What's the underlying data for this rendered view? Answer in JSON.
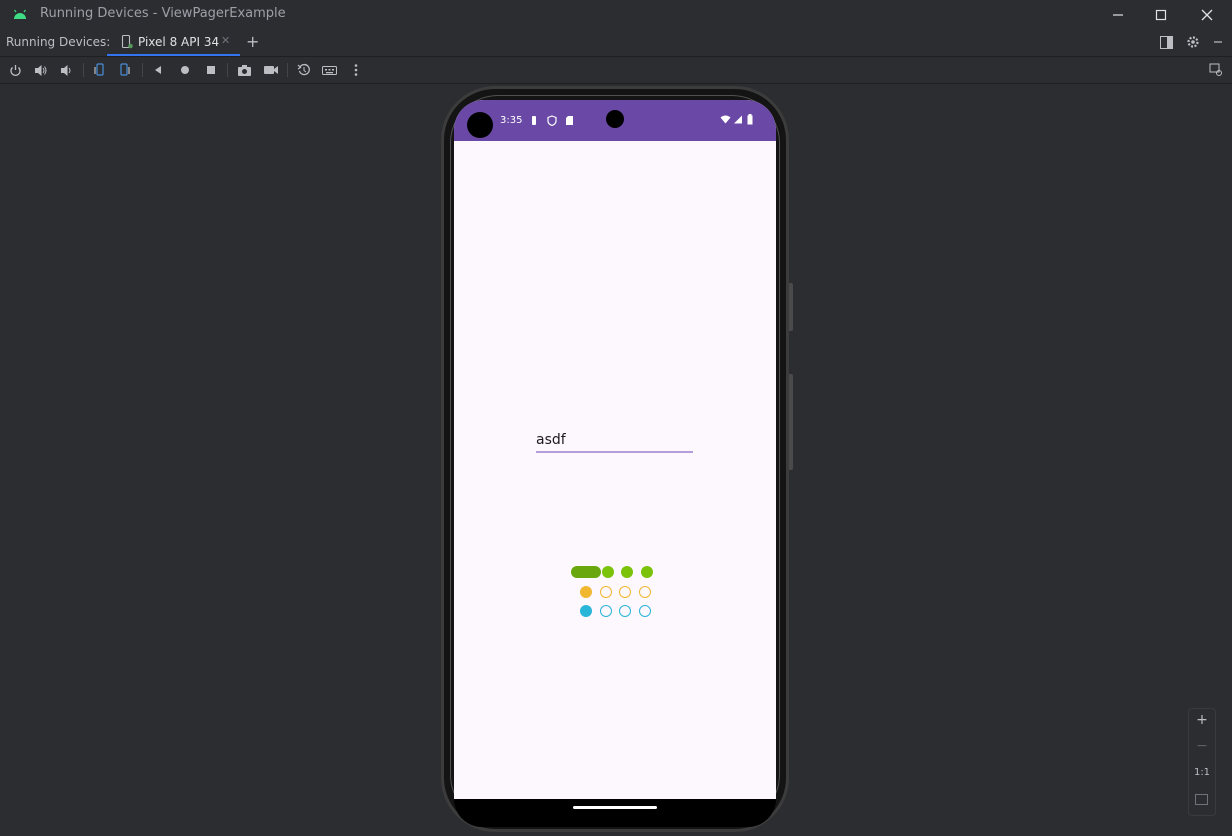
{
  "window": {
    "title": "Running Devices - ViewPagerExample",
    "controls": [
      "minimize-icon",
      "maximize-icon",
      "close-icon"
    ]
  },
  "tabbar": {
    "label": "Running Devices:",
    "tab": "Pixel 8 API 34",
    "add_icon": "+"
  },
  "toolbar": {
    "icons": [
      "power-icon",
      "volume-up-icon",
      "volume-down-icon",
      "rotate-left-icon",
      "rotate-right-icon",
      "back-icon",
      "home-icon",
      "overview-icon",
      "screenshot-icon",
      "screen-record-icon",
      "reset-icon",
      "keyboard-icon",
      "more-icon",
      "device-mirror-icon"
    ]
  },
  "device": {
    "status_time": "3:35",
    "edit_text": "asdf",
    "indicator_rows": [
      {
        "color": "#7bc20a",
        "active_color": "#6aa70f",
        "style": "filled",
        "count": 4,
        "active": 0
      },
      {
        "color": "#f2b731",
        "style": "outline",
        "count": 4,
        "active": 0
      },
      {
        "color": "#29b6d8",
        "style": "outline",
        "count": 4,
        "active": 0
      }
    ]
  },
  "zoom": {
    "zoom_in": "+",
    "zoom_out": "−",
    "actual": "1:1"
  },
  "colors": {
    "ide_bg": "#2b2d30",
    "statusbar": "#6a49a6",
    "screen_bg": "#fdf7fe",
    "accent_tab": "#3574f0",
    "edit_underline": "#b39ddb"
  }
}
